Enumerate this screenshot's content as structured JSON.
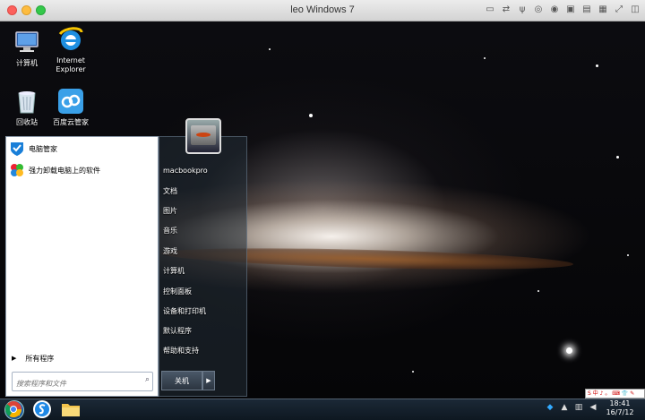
{
  "window": {
    "title": "leo Windows 7",
    "vm_toolbar_icons": [
      "display-icon",
      "network-icon",
      "usb-icon",
      "cd-icon",
      "sound-icon",
      "shared-folder-icon",
      "printer-icon",
      "keyboard-icon",
      "fullscreen-icon",
      "scale-icon"
    ]
  },
  "desktop": {
    "icons": [
      {
        "name": "computer",
        "label": "计算机"
      },
      {
        "name": "internet-explorer",
        "label_line1": "Internet",
        "label_line2": "Explorer"
      },
      {
        "name": "recycle-bin",
        "label": "回收站"
      },
      {
        "name": "baidu-cloud",
        "label": "百度云管家"
      }
    ]
  },
  "start_menu": {
    "pinned": [
      {
        "label": "电脑管家",
        "icon": "tencent-pc-manager-icon"
      },
      {
        "label": "强力卸载电脑上的软件",
        "icon": "uninstall-software-icon"
      }
    ],
    "all_programs": "所有程序",
    "search_placeholder": "搜索程序和文件",
    "user_name": "macbookpro",
    "right_items": [
      "文档",
      "图片",
      "音乐",
      "游戏",
      "计算机",
      "控制面板",
      "设备和打印机",
      "默认程序",
      "帮助和支持"
    ],
    "shutdown_label": "关机"
  },
  "taskbar": {
    "apps": [
      "chrome-icon",
      "sogou-browser-icon",
      "file-explorer-icon"
    ],
    "language_bar": "S 中 ♪ 。 ⌨ 👕 ✎",
    "clock_time": "18:41",
    "clock_date": "16/7/12"
  }
}
